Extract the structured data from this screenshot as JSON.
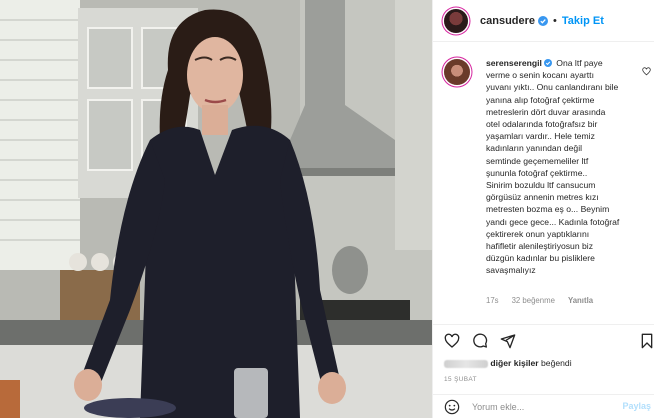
{
  "photo": {
    "description_icon": "photo-image"
  },
  "header": {
    "username": "cansudere",
    "separator": "•",
    "follow_label": "Takip Et",
    "verified_icon": "verified-badge-icon",
    "accent_color": "#0095f6"
  },
  "comment": {
    "username": "serenserengil",
    "lines": [
      "Ona ltf paye",
      "verme o senin kocanı ayarttı",
      "yuvanı yıktı.. Onu canlandıranı bile",
      "yanına alıp fotoğraf çektirme",
      "metreslerin dört duvar arasında",
      "otel odalarında fotoğrafsız bir",
      "yaşamları vardır.. Hele temiz",
      "kadınların yanından değil",
      "semtinde geçemem​eliler ltf",
      "şunun​la fotoğraf çektirme..",
      "Sinirim bozuldu ltf cansucum",
      "görgüsüz annenin metres kızı",
      "metresten bozma eş o... Beynim",
      "yandı gece gece... Kadınla fotoğraf",
      "çektirerek onun yaptıklarını",
      "hafifletir alenileştiriyosun biz",
      "düzgün kadınlar bu pisliklere",
      "savaşmalıyız"
    ],
    "time": "17s",
    "likes": "32 beğenme",
    "reply": "Yanıtla"
  },
  "actions": {
    "like_icon": "heart-icon",
    "comment_icon": "comment-icon",
    "share_icon": "share-icon",
    "save_icon": "bookmark-icon"
  },
  "likes_line": {
    "text": "diğer kişiler",
    "suffix": "beğendi"
  },
  "date": "15 ŞUBAT",
  "add_comment": {
    "placeholder": "Yorum ekle...",
    "post_label": "Paylaş"
  }
}
